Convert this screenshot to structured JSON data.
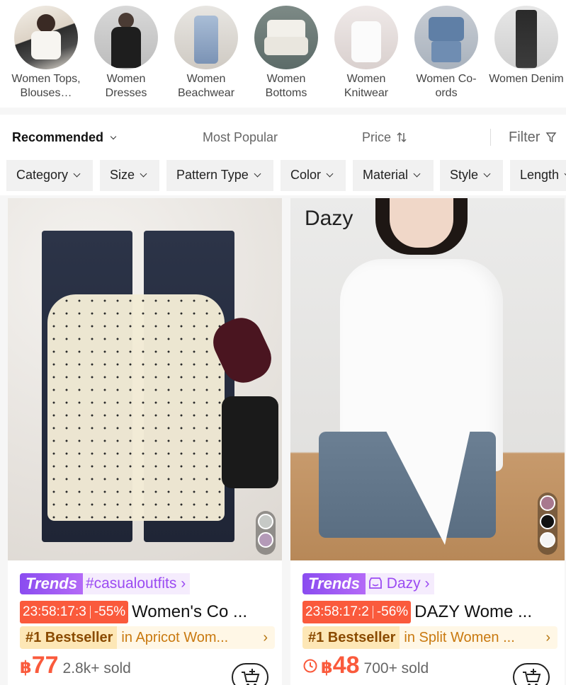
{
  "categories": [
    {
      "label": "Women Tops, Blouses…",
      "icon": "category-thumb"
    },
    {
      "label": "Women Dresses",
      "icon": "category-thumb"
    },
    {
      "label": "Women Beachwear",
      "icon": "category-thumb"
    },
    {
      "label": "Women Bottoms",
      "icon": "category-thumb"
    },
    {
      "label": "Women Knitwear",
      "icon": "category-thumb"
    },
    {
      "label": "Women Co-ords",
      "icon": "category-thumb"
    },
    {
      "label": "Women Denim",
      "icon": "category-thumb"
    }
  ],
  "sort": {
    "recommended": "Recommended",
    "most_popular": "Most Popular",
    "price": "Price",
    "filter": "Filter"
  },
  "filters": [
    "Category",
    "Size",
    "Pattern Type",
    "Color",
    "Material",
    "Style",
    "Length"
  ],
  "products": [
    {
      "trend_badge": "Trends",
      "trend_tag": "#casualoutfits",
      "countdown": "23:58:17:3",
      "discount": "-55%",
      "title": "Women's Co ...",
      "bestseller_badge": "#1 Bestseller",
      "bestseller_text": "in Apricot Wom...",
      "currency": "฿",
      "price": "77",
      "sold": "2.8k+ sold",
      "swatch_colors": [
        "#c6c9c6",
        "#b49ab8"
      ]
    },
    {
      "trend_badge": "Trends",
      "trend_tag": "Dazy",
      "watermark": "Dazy",
      "countdown": "23:58:17:2",
      "discount": "-56%",
      "title": "DAZY Wome ...",
      "bestseller_badge": "#1 Bestseller",
      "bestseller_text": "in Split Women ...",
      "currency": "฿",
      "price": "48",
      "sold": "700+ sold",
      "swatch_colors": [
        "#a8788e",
        "#111111",
        "#f4f4f4"
      ]
    }
  ],
  "colors": {
    "accent": "#fa5a3c",
    "trend": "#9b4bf2",
    "bestseller": "#c9790f"
  }
}
